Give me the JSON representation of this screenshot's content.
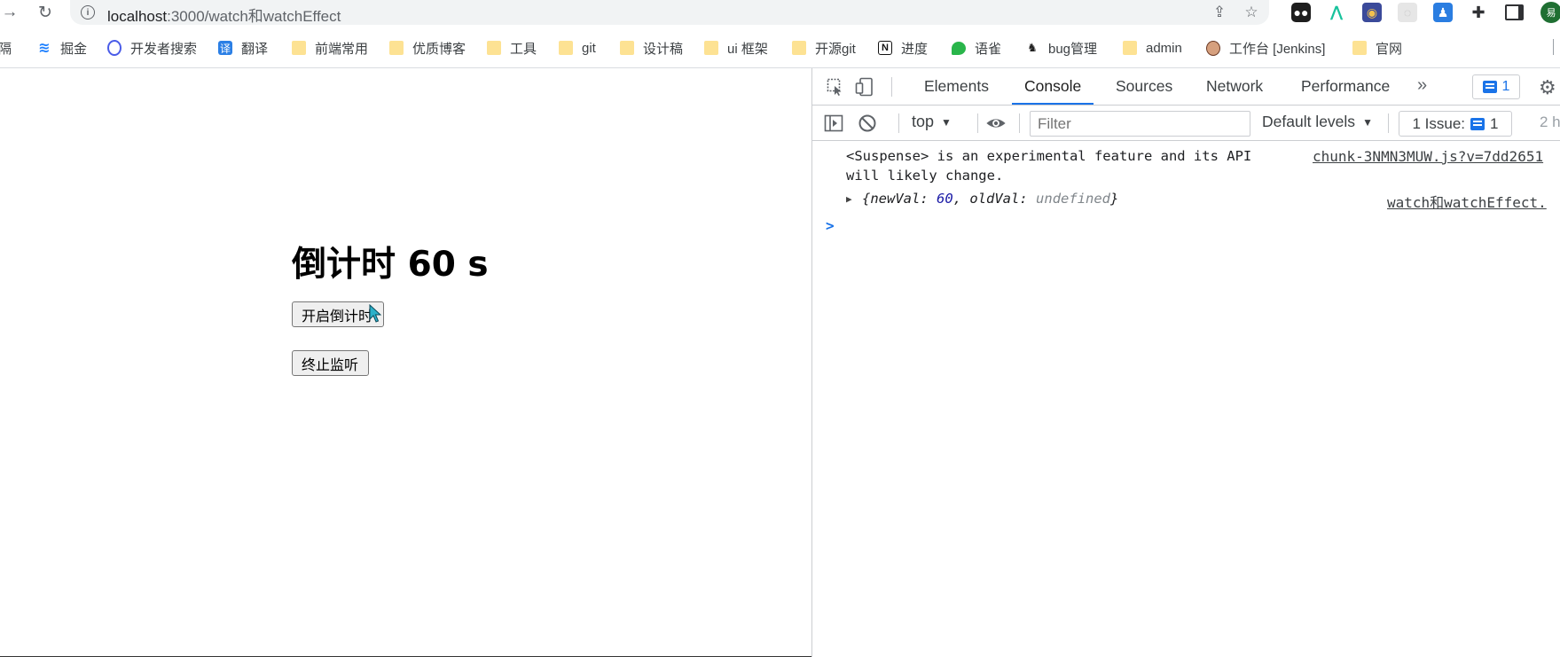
{
  "browser": {
    "url_host": "localhost",
    "url_path": ":3000/watch和watchEffect",
    "bookmarks": [
      {
        "label": "隔",
        "icon": "folder"
      },
      {
        "label": "掘金",
        "icon": "juejin-icon"
      },
      {
        "label": "开发者搜索",
        "icon": "dev-search-icon"
      },
      {
        "label": "翻译",
        "icon": "translate-icon"
      },
      {
        "label": "前端常用",
        "icon": "folder"
      },
      {
        "label": "优质博客",
        "icon": "folder"
      },
      {
        "label": "工具",
        "icon": "folder"
      },
      {
        "label": "git",
        "icon": "folder"
      },
      {
        "label": "设计稿",
        "icon": "folder"
      },
      {
        "label": "ui 框架",
        "icon": "folder"
      },
      {
        "label": "开源git",
        "icon": "folder"
      },
      {
        "label": "进度",
        "icon": "notion-icon"
      },
      {
        "label": "语雀",
        "icon": "yuque-icon"
      },
      {
        "label": "bug管理",
        "icon": "bug-icon"
      },
      {
        "label": "admin",
        "icon": "folder"
      },
      {
        "label": "工作台 [Jenkins]",
        "icon": "jenkins-icon"
      },
      {
        "label": "官网",
        "icon": "folder"
      }
    ],
    "profile_initial": "易"
  },
  "page": {
    "countdown_text": "倒计时 60 s",
    "start_button": "开启倒计时",
    "stop_button": "终止监听"
  },
  "devtools": {
    "tabs": [
      "Elements",
      "Console",
      "Sources",
      "Network",
      "Performance"
    ],
    "active_tab": "Console",
    "message_count": "1",
    "context": "top",
    "filter_placeholder": "Filter",
    "levels": "Default levels",
    "issues_label": "1 Issue:",
    "issues_count": "1",
    "hidden_count": "2 h",
    "console": {
      "warning_line1": "<Suspense> is an experimental feature and its API",
      "warning_line2": "will likely change.",
      "warning_source": "chunk-3NMN3MUW.js?v=7dd2651",
      "log_brace_open": "{",
      "log_key1": "newVal",
      "log_val1": "60",
      "log_key2": "oldVal",
      "log_val2": "undefined",
      "log_brace_close": "}",
      "log_source": "watch和watchEffect.",
      "prompt": ">"
    }
  },
  "colors": {
    "accent": "#1a73e8",
    "number": "#1a1aa6",
    "folder": "#fde293"
  }
}
